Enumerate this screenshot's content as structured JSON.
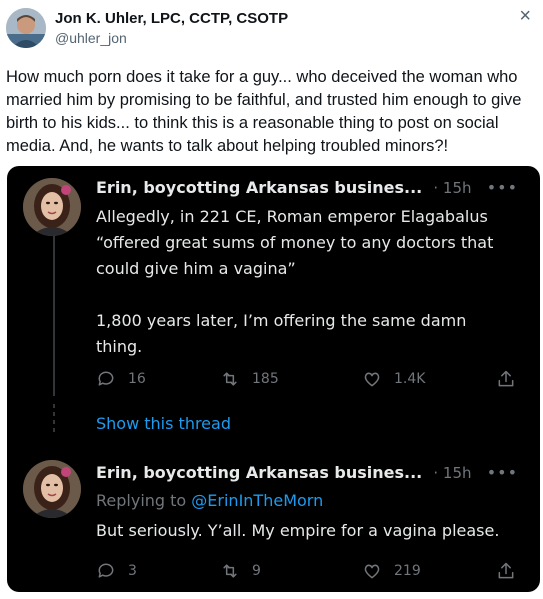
{
  "outer": {
    "name": "Jon K. Uhler, LPC, CCTP, CSOTP",
    "handle": "@uhler_jon",
    "close_glyph": "×",
    "text": "How much porn does it take for a guy... who deceived the woman who married him by promising to be faithful, and trusted him enough to give birth to his kids... to think this is a reasonable thing to post on social media. And, he wants to talk about helping troubled minors?!"
  },
  "embed": {
    "tweet1": {
      "name": "Erin, boycotting Arkansas busines...",
      "time": "· 15h",
      "more": "•••",
      "text": "Allegedly, in 221 CE, Roman emperor Elagabalus “offered great sums of money to any doctors that could give him a vagina”\n\n1,800 years later, I’m offering the same damn thing.",
      "replies": "16",
      "retweets": "185",
      "likes": "1.4K"
    },
    "show_thread": "Show this thread",
    "tweet2": {
      "name": "Erin, boycotting Arkansas busines...",
      "time": "· 15h",
      "more": "•••",
      "replying_prefix": "Replying to",
      "replying_to": "@ErinInTheMorn",
      "text": "But seriously. Y’all. My empire for a vagina please.",
      "replies": "3",
      "retweets": "9",
      "likes": "219"
    }
  },
  "colors": {
    "link": "#1d9bf0",
    "muted": "#71767b",
    "embed_bg": "#000000"
  },
  "icons": [
    "reply-icon",
    "retweet-icon",
    "like-icon",
    "share-icon",
    "more-icon"
  ]
}
